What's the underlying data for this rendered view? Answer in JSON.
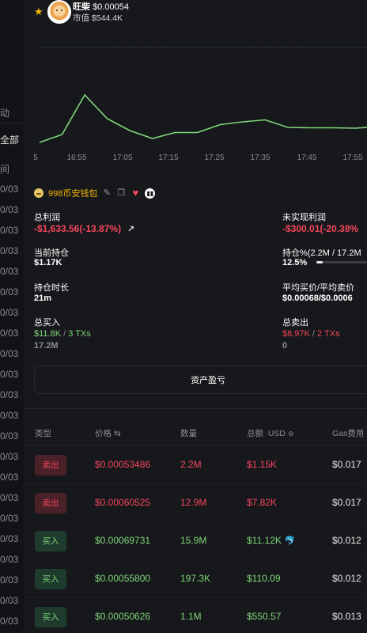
{
  "background_sidebar": {
    "items": [
      "动",
      "全部",
      "间",
      "0/03",
      "0/03",
      "0/03",
      "0/03",
      "0/03",
      "0/03",
      "0/03",
      "0/03",
      "0/03",
      "0/03",
      "0/03",
      "0/03",
      "0/03",
      "0/03",
      "0/03",
      "0/03",
      "0/03",
      "0/03",
      "0/03",
      "0/03",
      "0/03",
      "0/03",
      "0/03",
      "0/03",
      "0/03",
      "0/03"
    ]
  },
  "header": {
    "token_name": "旺柴",
    "price": "$0.00054",
    "market_cap": "市值 $544.4K"
  },
  "chart_data": {
    "type": "line",
    "x_ticks": [
      "5",
      "16:55",
      "17:05",
      "17:15",
      "17:25",
      "17:35",
      "17:45",
      "17:55"
    ],
    "values": [
      0.00054,
      0.00056,
      0.00066,
      0.0006,
      0.00057,
      0.00055,
      0.000565,
      0.000565,
      0.000585,
      0.000592,
      0.000597,
      0.000578,
      0.000577,
      0.000577,
      0.000576,
      0.00058
    ],
    "color": "#7fd67a",
    "grid": false
  },
  "wallet": {
    "name": "998币安钱包"
  },
  "stats": {
    "total_profit_label": "总利润",
    "total_profit_value": "-$1,633.56(-13.87%)",
    "unrealized_label": "未实现利润",
    "unrealized_value": "-$300.01(-20.38%",
    "holding_label": "当前持仓",
    "holding_value": "$1.17K",
    "holding_pct_label": "持仓%(2.2M / 17.2M",
    "holding_pct_value": "12.5%",
    "holding_pct": 0.125,
    "duration_label": "持仓时长",
    "duration_value": "21m",
    "avg_price_label": "平均买价/平均卖价",
    "avg_price_value": "$0.00068/$0.0006",
    "total_buy_label": "总买入",
    "total_buy_amount": "$11.8K",
    "total_buy_sep": " / ",
    "total_buy_txs": "3 TXs",
    "total_buy_qty": "17.2M",
    "total_sell_label": "总卖出",
    "total_sell_amount": "$8.97K",
    "total_sell_sep": " / ",
    "total_sell_txs": "2 TXs",
    "total_sell_qty": "0"
  },
  "pnl_button": "资产盈亏",
  "table": {
    "headers": {
      "type": "类型",
      "price": "价格 ⇆",
      "qty": "数量",
      "total": "总额",
      "currency": "USD",
      "gas": "Gas费用"
    },
    "rows": [
      {
        "type": "卖出",
        "price": "$0.00053486",
        "qty": "2.2M",
        "total": "$1.15K",
        "gas": "$0.017"
      },
      {
        "type": "卖出",
        "price": "$0.00060525",
        "qty": "12.9M",
        "total": "$7.82K",
        "gas": "$0.017"
      },
      {
        "type": "买入",
        "price": "$0.00069731",
        "qty": "15.9M",
        "total": "$11.12K",
        "gas": "$0.012"
      },
      {
        "type": "买入",
        "price": "$0.00055800",
        "qty": "197.3K",
        "total": "$110.09",
        "gas": "$0.012"
      },
      {
        "type": "买入",
        "price": "$0.00050626",
        "qty": "1.1M",
        "total": "$550.57",
        "gas": "$0.013"
      }
    ]
  }
}
